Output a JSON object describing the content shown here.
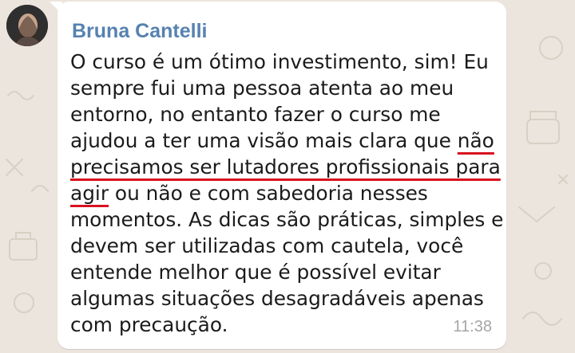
{
  "chat": {
    "sender_name": "Bruna Cantelli",
    "message": {
      "part_before": "O curso é um ótimo investimento, sim! Eu sempre fui uma pessoa atenta ao meu entorno, no entanto fazer o curso me ajudou a ter uma visão mais clara que ",
      "part_highlight": "não precisamos ser lutadores profissionais para agir",
      "part_after": " ou não e com sabedoria nesses momentos. As dicas são práticas, simples e devem ser utilizadas com cautela, você entende melhor que é possível evitar algumas situações desagradáveis apenas com precaução."
    },
    "timestamp": "11:38"
  },
  "colors": {
    "background": "#ece5dd",
    "bubble": "#ffffff",
    "sender_name": "#5682b0",
    "highlight_underline": "#d8121f",
    "timestamp": "#a5a5a5"
  }
}
